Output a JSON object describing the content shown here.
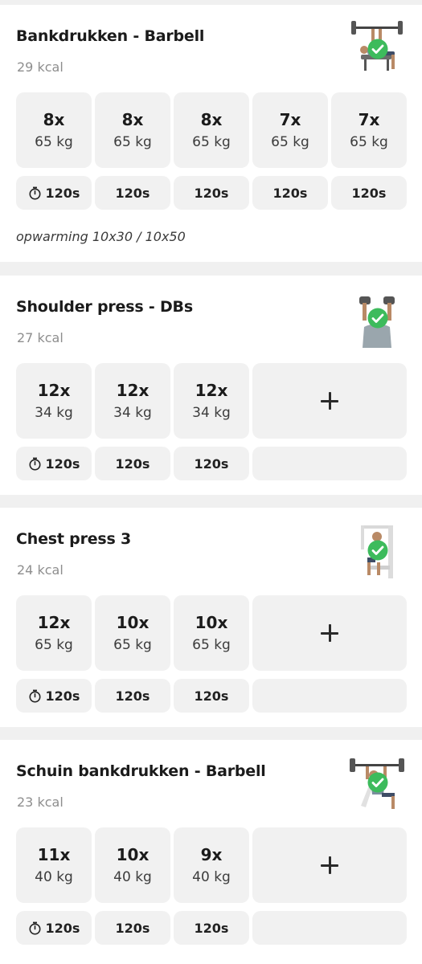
{
  "exercises": [
    {
      "title": "Bankdrukken - Barbell",
      "kcal": "29 kcal",
      "image": "bench-press-barbell-illustration",
      "sets": [
        {
          "reps": "8x",
          "weight": "65 kg"
        },
        {
          "reps": "8x",
          "weight": "65 kg"
        },
        {
          "reps": "8x",
          "weight": "65 kg"
        },
        {
          "reps": "7x",
          "weight": "65 kg"
        },
        {
          "reps": "7x",
          "weight": "65 kg"
        }
      ],
      "rests": [
        "120s",
        "120s",
        "120s",
        "120s",
        "120s"
      ],
      "note": "opwarming 10x30 / 10x50"
    },
    {
      "title": "Shoulder press - DBs",
      "kcal": "27 kcal",
      "image": "shoulder-press-dumbbell-illustration",
      "sets": [
        {
          "reps": "12x",
          "weight": "34 kg"
        },
        {
          "reps": "12x",
          "weight": "34 kg"
        },
        {
          "reps": "12x",
          "weight": "34 kg"
        }
      ],
      "rests": [
        "120s",
        "120s",
        "120s"
      ]
    },
    {
      "title": "Chest press 3",
      "kcal": "24 kcal",
      "image": "chest-press-machine-illustration",
      "sets": [
        {
          "reps": "12x",
          "weight": "65 kg"
        },
        {
          "reps": "10x",
          "weight": "65 kg"
        },
        {
          "reps": "10x",
          "weight": "65 kg"
        }
      ],
      "rests": [
        "120s",
        "120s",
        "120s"
      ]
    },
    {
      "title": "Schuin bankdrukken - Barbell",
      "kcal": "23 kcal",
      "image": "incline-bench-press-illustration",
      "sets": [
        {
          "reps": "11x",
          "weight": "40 kg"
        },
        {
          "reps": "10x",
          "weight": "40 kg"
        },
        {
          "reps": "9x",
          "weight": "40 kg"
        }
      ],
      "rests": [
        "120s",
        "120s",
        "120s"
      ]
    }
  ],
  "icons": {
    "add": "plus-icon",
    "rest": "stopwatch-icon",
    "completed": "check-circle-icon"
  },
  "colors": {
    "card_background": "#ffffff",
    "page_background": "#f0f0f0",
    "cell_background": "#f1f1f1",
    "completed_badge": "#3dbb5c",
    "secondary_text": "#8e8e8e"
  }
}
